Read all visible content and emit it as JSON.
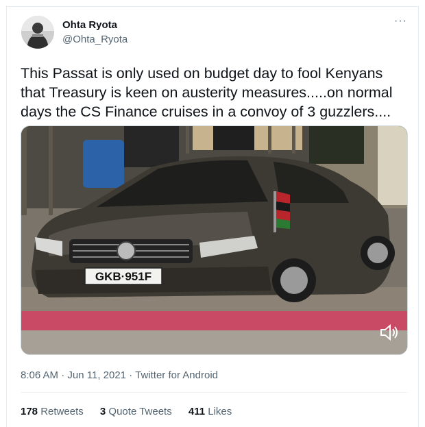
{
  "tweet": {
    "author_name": "Ohta Ryota",
    "author_handle": "@Ohta_Ryota",
    "more_label": "···",
    "text": "This Passat is only used on budget day to fool Kenyans\nthat Treasury is keen on austerity measures.....on normal\ndays the CS Finance cruises in a convoy of 3 guzzlers....",
    "media": {
      "plate_text": "GKB·951F",
      "sound_icon": "speaker-icon"
    },
    "time": "8:06 AM",
    "separator": "·",
    "date": "Jun 11, 2021",
    "source": "Twitter for Android"
  },
  "stats": {
    "retweets_count": "178",
    "retweets_label": "Retweets",
    "quotes_count": "3",
    "quotes_label": "Quote Tweets",
    "likes_count": "411",
    "likes_label": "Likes"
  }
}
